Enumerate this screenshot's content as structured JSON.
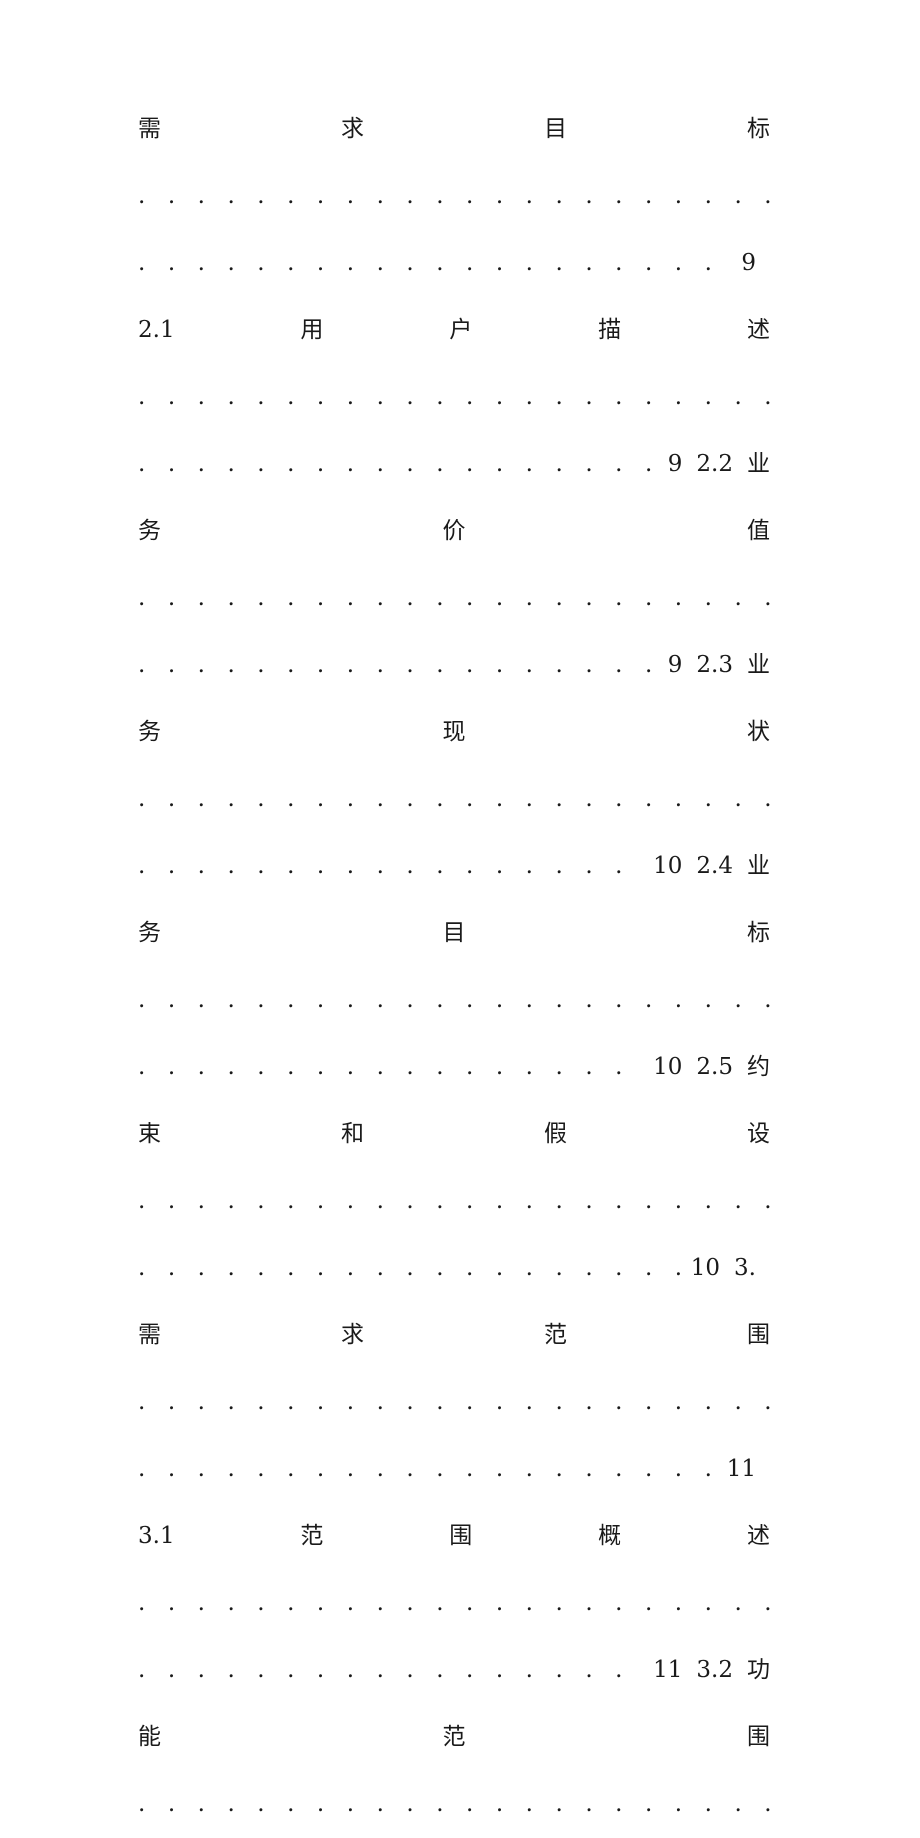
{
  "document": {
    "type": "table-of-contents",
    "language": "zh-CN",
    "page_background": "#ffffff",
    "text_color": "#1a1a1a"
  },
  "lines": [
    {
      "kind": "spread",
      "chars": [
        "需",
        "求",
        "目",
        "标"
      ]
    },
    {
      "kind": "dots",
      "dots": ". . . . . . . . . . . . . . . . . . . . . . . . . . . . . . . . . . . . . . . . . . . . . . . . . . . . . . . . . . . . . . . . . ."
    },
    {
      "kind": "dots-end",
      "dots": ". . . . . . . . . . . . . . . . . . . . . . . . . . . . . . . . . . . . . . . . . . . . . . . . .",
      "page": "9",
      "next_section": "",
      "next_char": ""
    },
    {
      "kind": "spread",
      "chars": [
        "2.1",
        "用",
        "户",
        "描",
        "述"
      ]
    },
    {
      "kind": "dots",
      "dots": ". . . . . . . . . . . . . . . . . . . . . . . . . . . . . . . . . . . . . . . . . . . . . . . . . . . . . . . . . . . . . . . . . ."
    },
    {
      "kind": "dots-end",
      "dots": ". . . . . . . . . . . . . . . . . . . . . . . . . . . . . . . . . . . . . . . . . . .",
      "page": "9",
      "next_section": "2.2",
      "next_char": "业"
    },
    {
      "kind": "spread",
      "chars": [
        "务",
        "价",
        "值"
      ]
    },
    {
      "kind": "dots",
      "dots": ". . . . . . . . . . . . . . . . . . . . . . . . . . . . . . . . . . . . . . . . . . . . . . . . . . . . . . . . . . . . . . . . . ."
    },
    {
      "kind": "dots-end",
      "dots": ". . . . . . . . . . . . . . . . . . . . . . . . . . . . . . . . . . . . . . . . . . .",
      "page": "9",
      "next_section": "2.3",
      "next_char": "业"
    },
    {
      "kind": "spread",
      "chars": [
        "务",
        "现",
        "状"
      ]
    },
    {
      "kind": "dots",
      "dots": ". . . . . . . . . . . . . . . . . . . . . . . . . . . . . . . . . . . . . . . . . . . . . . . . . . . . . . . . . . . . . . . . . ."
    },
    {
      "kind": "dots-end",
      "dots": ". . . . . . . . . . . . . . . . . . . . . . . . . . . . . . . . . . . . . . . . .",
      "page": "10",
      "next_section": "2.4",
      "next_char": "业"
    },
    {
      "kind": "spread",
      "chars": [
        "务",
        "目",
        "标"
      ]
    },
    {
      "kind": "dots",
      "dots": ". . . . . . . . . . . . . . . . . . . . . . . . . . . . . . . . . . . . . . . . . . . . . . . . . . . . . . . . . . . . . . . . . ."
    },
    {
      "kind": "dots-end",
      "dots": ". . . . . . . . . . . . . . . . . . . . . . . . . . . . . . . . . . . . . . . . .",
      "page": "10",
      "next_section": "2.5",
      "next_char": "约"
    },
    {
      "kind": "spread",
      "chars": [
        "束",
        "和",
        "假",
        "设"
      ]
    },
    {
      "kind": "dots",
      "dots": ". . . . . . . . . . . . . . . . . . . . . . . . . . . . . . . . . . . . . . . . . . . . . . . . . . . . . . . . . . . . . . . . . ."
    },
    {
      "kind": "dots-end",
      "dots": ". . . . . . . . . . . . . . . . . . . . . . . . . . . . . . . . . . . . . . .",
      "page": "10",
      "next_section": "3.",
      "next_char": ""
    },
    {
      "kind": "spread",
      "chars": [
        "需",
        "求",
        "范",
        "围"
      ]
    },
    {
      "kind": "dots",
      "dots": ". . . . . . . . . . . . . . . . . . . . . . . . . . . . . . . . . . . . . . . . . . . . . . . . . . . . . . . . . . . . . . . . . ."
    },
    {
      "kind": "dots-end",
      "dots": ". . . . . . . . . . . . . . . . . . . . . . . . . . . . . . . . . . . . . . . . . . . . . . .",
      "page": "11",
      "next_section": "",
      "next_char": ""
    },
    {
      "kind": "spread",
      "chars": [
        "3.1",
        "范",
        "围",
        "概",
        "述"
      ]
    },
    {
      "kind": "dots",
      "dots": ". . . . . . . . . . . . . . . . . . . . . . . . . . . . . . . . . . . . . . . . . . . . . . . . . . . . . . . . . . . . . . . . . ."
    },
    {
      "kind": "dots-end",
      "dots": ". . . . . . . . . . . . . . . . . . . . . . . . . . . . . . . . . . . . . . . .",
      "page": "11",
      "next_section": "3.2",
      "next_char": "功"
    },
    {
      "kind": "spread",
      "chars": [
        "能",
        "范",
        "围"
      ]
    },
    {
      "kind": "dots",
      "dots": ". . . . . . . . . . . . . . . . . . . . . . . . . . . . . . . . . . . . . . . . . . . . . . . . . . . . . . . . . . . . . . . . . ."
    }
  ]
}
